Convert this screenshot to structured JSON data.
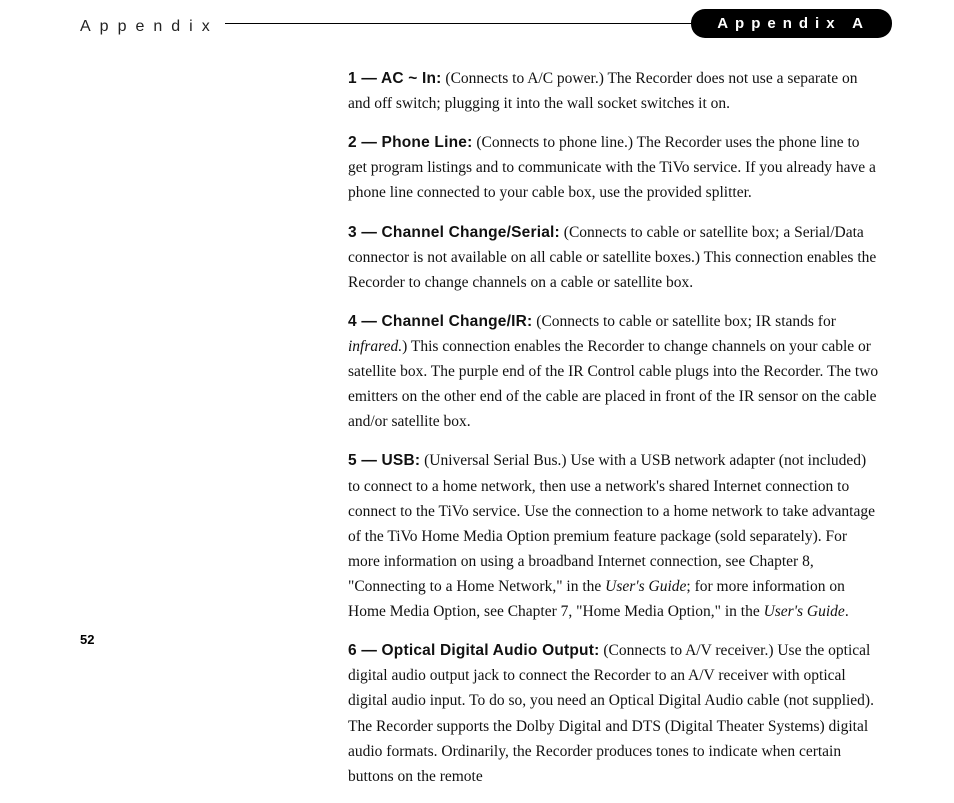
{
  "header": {
    "left": "Appendix",
    "right": "Appendix A"
  },
  "page_number": "52",
  "items": [
    {
      "label": "1 — AC ~ In:",
      "text_before_italic": " (Connects to A/C power.) The Recorder does not use a separate on and off switch; plugging it into the wall socket switches it on.",
      "italics": [],
      "tail": ""
    },
    {
      "label": "2 — Phone Line:",
      "text_before_italic": " (Connects to phone line.) The Recorder uses the phone line to get program listings and to communicate with the TiVo service. If you already have a phone line connected to your cable box, use the provided splitter.",
      "italics": [],
      "tail": ""
    },
    {
      "label": "3 — Channel Change/Serial:",
      "text_before_italic": " (Connects to cable or satellite box; a Serial/Data connector is not available on all cable or satellite boxes.) This connection enables the Recorder to change channels on a cable or satellite box.",
      "italics": [],
      "tail": ""
    },
    {
      "label": "4 — Channel Change/IR:",
      "text_before_italic": " (Connects to cable or satellite box; IR stands for ",
      "italics": [
        {
          "text": "infrared.",
          "after": ") This connection enables the Recorder to change channels on your cable or satellite box.  The purple end of the IR Control cable plugs into the Recorder. The two emitters on the other end of the cable are placed in front of the IR sensor on the cable and/or satellite box."
        }
      ],
      "tail": ""
    },
    {
      "label": "5 — USB:",
      "text_before_italic": " (Universal Serial Bus.) Use with a USB network adapter (not included) to connect to a home network, then use a network's shared Internet connection to connect to the TiVo service. Use the connection to a home network to take advantage of the TiVo Home Media Option premium feature package (sold separately). For more information on using a broadband Internet connection, see Chapter 8, \"Connecting to a Home Network,\" in the ",
      "italics": [
        {
          "text": "User's Guide",
          "after": "; for more information on Home Media Option, see Chapter 7, \"Home Media Option,\" in the "
        },
        {
          "text": "User's Guide",
          "after": "."
        }
      ],
      "tail": ""
    },
    {
      "label": "6 — Optical Digital Audio Output:",
      "text_before_italic": " (Connects to A/V receiver.) Use the optical digital audio output jack to connect the Recorder to an A/V receiver with optical digital audio input. To do so, you need an Optical Digital Audio cable (not supplied). The Recorder supports the Dolby Digital and DTS (Digital Theater Systems) digital audio formats. Ordinarily, the Recorder produces tones to indicate when certain buttons on the remote",
      "italics": [],
      "tail": ""
    }
  ]
}
